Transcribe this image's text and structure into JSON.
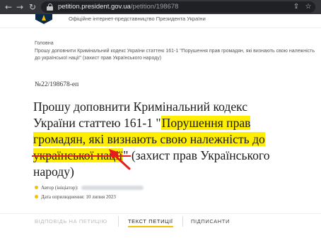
{
  "browser": {
    "url_domain": "petition.president.gov.ua",
    "url_path": "/petition/198678"
  },
  "site": {
    "tagline": "Офіційне інтернет-представництво Президента України"
  },
  "breadcrumb": {
    "home": "Головна",
    "current": "Прошу доповнити Кримінальний кодекс України статтею 161-1 \"Порушення прав громадян, які визнають свою належність до української нації\" (захист прав Українського народу)"
  },
  "petition": {
    "number": "№22/198678-еп",
    "title_part1": "Прошу доповнити Кримінальний кодекс України статтею 161-1 \"",
    "title_highlight": "Порушення прав громадян, які визнають свою належність до української нації",
    "title_part2": "\" (захист прав Українського народу)",
    "author_label": "Автор (ініціатор):",
    "published": "Дата оприлюднення: 10 липня 2023"
  },
  "tabs": [
    {
      "label": "ВІДПОВІДЬ НА ПЕТИЦІЮ",
      "state": "disabled"
    },
    {
      "label": "ТЕКСТ ПЕТИЦІЇ",
      "state": "active"
    },
    {
      "label": "ПІДПИСАНТИ",
      "state": "normal"
    }
  ],
  "colors": {
    "highlight": "#ffee00",
    "annotation": "#e81c1c",
    "accent": "#f2c200"
  }
}
